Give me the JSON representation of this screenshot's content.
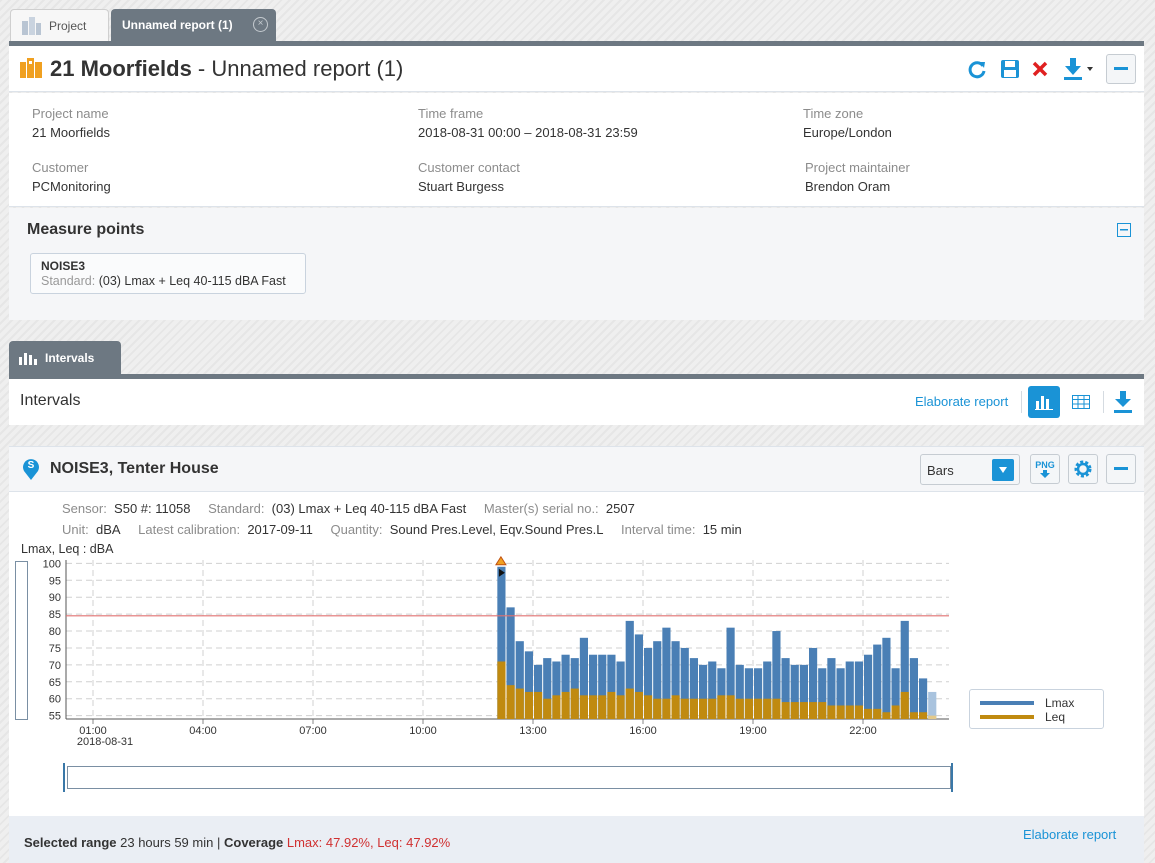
{
  "tabs": {
    "project": "Project",
    "report": "Unnamed report (1)",
    "close_glyph": "×"
  },
  "header": {
    "project": "21 Moorfields",
    "separator": " - ",
    "report": "Unnamed report (1)"
  },
  "info": {
    "project_name_label": "Project name",
    "project_name": "21 Moorfields",
    "time_frame_label": "Time frame",
    "time_frame": "2018-08-31 00:00 – 2018-08-31 23:59",
    "time_zone_label": "Time zone",
    "time_zone": "Europe/London",
    "customer_label": "Customer",
    "customer": "PCMonitoring",
    "customer_contact_label": "Customer contact",
    "customer_contact": "Stuart Burgess",
    "maintainer_label": "Project maintainer",
    "maintainer": "Brendon Oram"
  },
  "measure_points": {
    "title": "Measure points",
    "item_name": "NOISE3",
    "item_standard_label": "Standard:",
    "item_standard": "(03) Lmax + Leq 40-115 dBA Fast"
  },
  "intervals_tab": "Intervals",
  "intervals_section": {
    "title": "Intervals",
    "elaborate": "Elaborate report"
  },
  "noise": {
    "title": "NOISE3, Tenter House",
    "marker": "S",
    "chart_mode": "Bars",
    "png_label": "PNG",
    "sensor_label": "Sensor:",
    "sensor": "S50 #: 11058",
    "standard_label": "Standard:",
    "standard": "(03) Lmax + Leq 40-115 dBA Fast",
    "master_label": "Master(s) serial no.:",
    "master": "2507",
    "unit_label": "Unit:",
    "unit": "dBA",
    "calib_label": "Latest calibration:",
    "calib": "2017-09-11",
    "quantity_label": "Quantity:",
    "quantity": "Sound Pres.Level, Eqv.Sound Pres.L",
    "interval_label": "Interval time:",
    "interval": "15 min"
  },
  "footer": {
    "range_label": "Selected range",
    "range": "23 hours 59 min",
    "sep": "|",
    "coverage_label": "Coverage",
    "coverage": "Lmax: 47.92%, Leq: 47.92%",
    "elaborate": "Elaborate report"
  },
  "colors": {
    "lmax": "#4a7fb5",
    "leq": "#c08a10",
    "accent": "#1a93d6",
    "limit": "#e07070",
    "brand": "#f0a020"
  },
  "chart_data": {
    "type": "bar",
    "ylabel": "Lmax, Leq : dBA",
    "ylim": [
      54,
      101
    ],
    "y_ticks": [
      55,
      60,
      65,
      70,
      75,
      80,
      85,
      90,
      95,
      100
    ],
    "x_ticks": [
      "01:00",
      "04:00",
      "07:00",
      "10:00",
      "13:00",
      "16:00",
      "19:00",
      "22:00"
    ],
    "x_date_label": "2018-08-31",
    "limit": 84.5,
    "x_start": "12:15",
    "x_interval": "15 min",
    "series": [
      {
        "name": "Lmax",
        "values": [
          99,
          87,
          77,
          74,
          70,
          72,
          71,
          73,
          72,
          78,
          73,
          73,
          73,
          71,
          83,
          79,
          75,
          77,
          81,
          77,
          75,
          72,
          70,
          71,
          69,
          81,
          70,
          69,
          69,
          71,
          80,
          72,
          70,
          70,
          75,
          69,
          72,
          69,
          71,
          71,
          73,
          76,
          78,
          69,
          83,
          72,
          66,
          62
        ]
      },
      {
        "name": "Leq",
        "values": [
          71,
          64,
          63,
          62,
          62,
          60,
          61,
          62,
          63,
          61,
          61,
          61,
          62,
          61,
          63,
          62,
          61,
          60,
          60,
          61,
          60,
          60,
          60,
          60,
          61,
          61,
          60,
          60,
          60,
          60,
          60,
          59,
          59,
          59,
          59,
          59,
          58,
          58,
          58,
          58,
          57,
          57,
          56,
          58,
          62,
          56,
          56,
          55
        ]
      }
    ],
    "legend": "right"
  }
}
